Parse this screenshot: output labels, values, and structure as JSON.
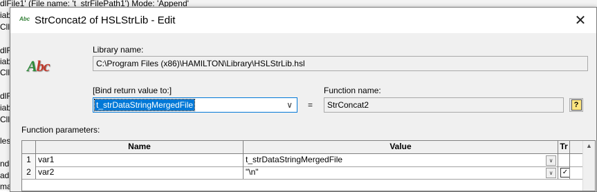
{
  "background": {
    "lines": [
      "dlFile1' (File name: 't_strFilePath1')   Mode: 'Append'",
      "iab",
      "Cll T",
      "dlF",
      "iab",
      "Cll T",
      "dlF",
      "iab",
      "Cll T",
      "les",
      "nde",
      "ad",
      "ma"
    ]
  },
  "dialog": {
    "title": "StrConcat2 of HSLStrLib - Edit",
    "title_icon_text": "Abc",
    "close_glyph": "✕",
    "logo": {
      "a": "A",
      "bc": "bc"
    },
    "library_label": "Library name:",
    "library_value": "C:\\Program Files (x86)\\HAMILTON\\Library\\HSLStrLib.hsl",
    "bind_label": "[Bind return value to:]",
    "bind_value": "t_strDataStringMergedFile",
    "equals": "=",
    "function_label": "Function name:",
    "function_value": "StrConcat2",
    "help_glyph": "?",
    "params_label": "Function parameters:"
  },
  "params_table": {
    "columns": [
      "Name",
      "Value",
      "Tr"
    ],
    "rows": [
      {
        "index": "1",
        "name": "var1",
        "value": "t_strDataStringMergedFile",
        "tr": ""
      },
      {
        "index": "2",
        "name": "var2",
        "value": "\"\\n\"",
        "tr": "✓"
      }
    ]
  }
}
